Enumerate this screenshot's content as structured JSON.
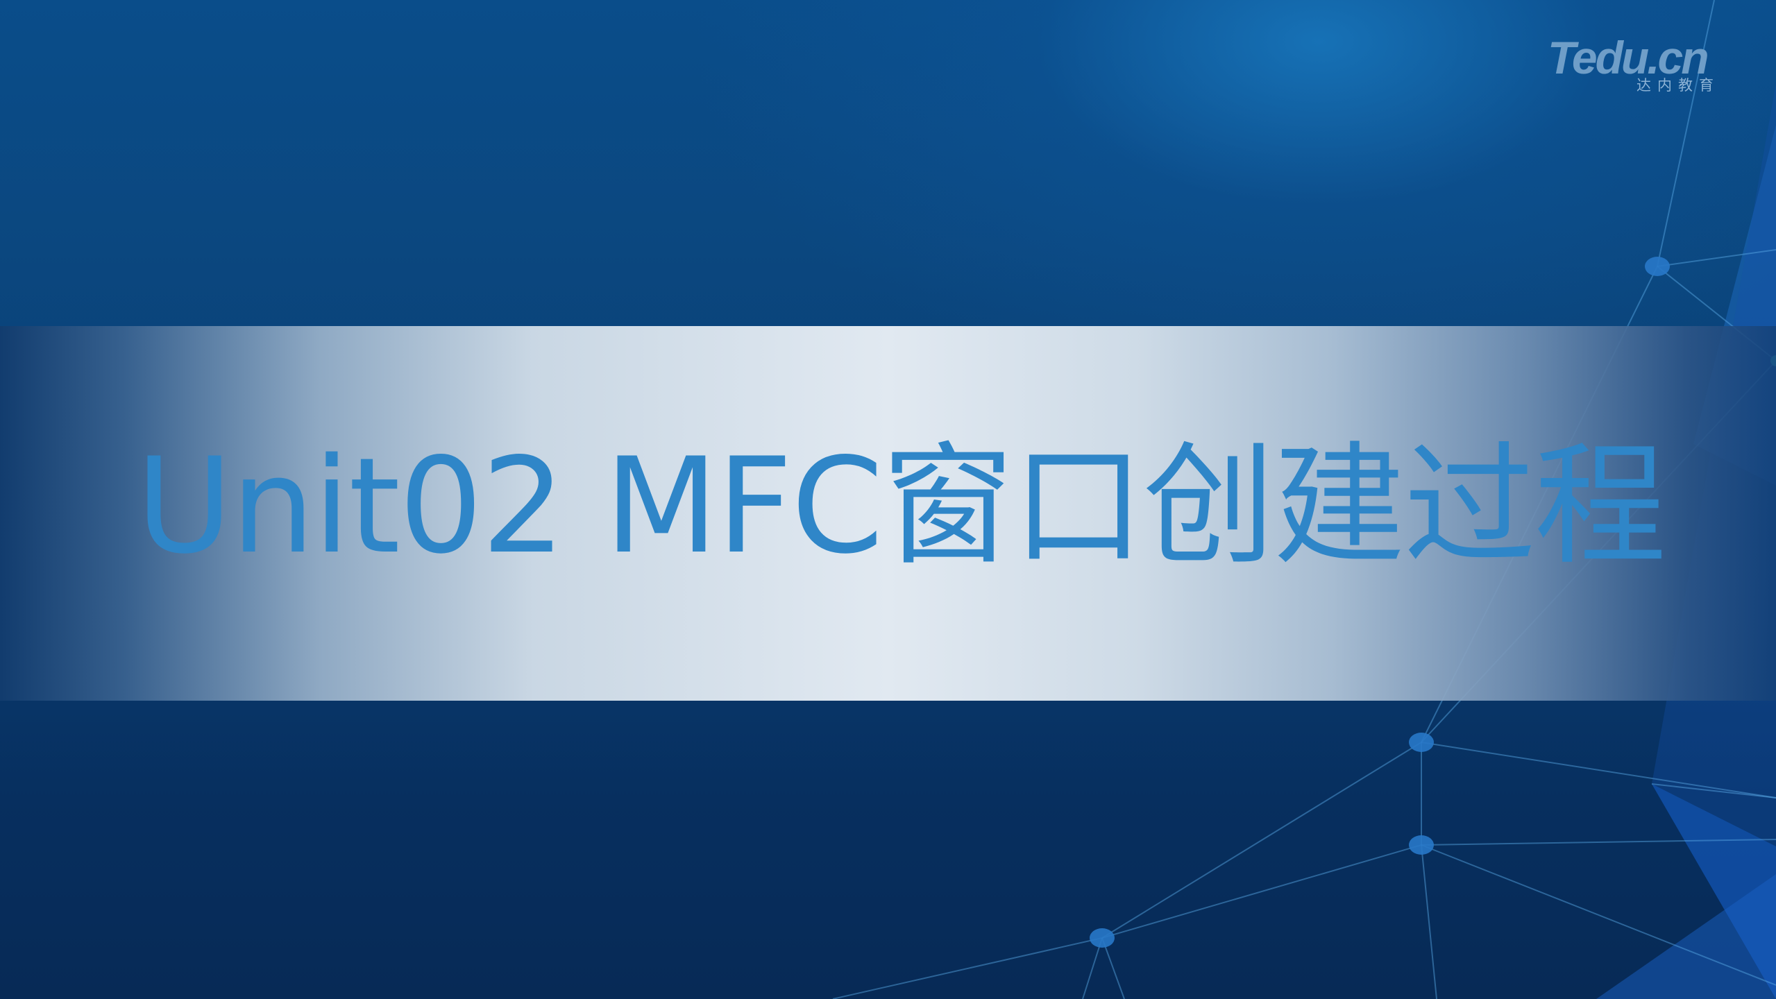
{
  "slide": {
    "title": "Unit02 MFC窗口创建过程",
    "logo": {
      "main": "Tedu.cn",
      "sub": "达内教育"
    }
  },
  "colors": {
    "background_top": "#0a4d8a",
    "background_bottom": "#072a56",
    "title_text": "#2f86c8",
    "band_center": "#e1e9f1",
    "logo": "#6f9ec8"
  }
}
